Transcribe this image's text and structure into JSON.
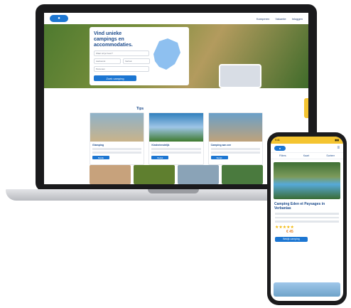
{
  "laptop": {
    "nav": {
      "a": "Kamperen",
      "b": "Vakantie",
      "c": "Inloggen"
    },
    "hero_title": "Vind unieke campings en accommodaties.",
    "search_placeholder": "Waar wil je heen?",
    "date_in": "Aankomst",
    "date_out": "Vertrek",
    "guests": "Personen",
    "search_button": "Zoek camping",
    "section": "Tips",
    "cards": [
      {
        "title": "Glamping",
        "button": "Bekijk"
      },
      {
        "title": "Kindvriendelijk",
        "button": "Bekijk"
      },
      {
        "title": "Camping aan zee",
        "button": "Bekijk"
      }
    ]
  },
  "phone": {
    "time": "9:41",
    "tabs": [
      "Filters",
      "Kaart",
      "Sorteer"
    ],
    "camping_title": "Camping Eden et Paysages in Verbanias",
    "price": "€ 45",
    "button": "Bekijk camping",
    "stars": "★★★★★"
  },
  "colors": {
    "brand": "#1c76d2",
    "accent": "#f4c430"
  }
}
